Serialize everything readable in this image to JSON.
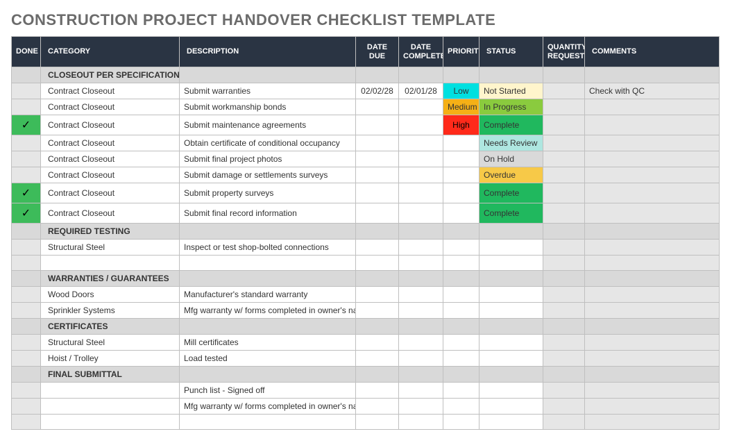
{
  "title": "CONSTRUCTION PROJECT HANDOVER CHECKLIST TEMPLATE",
  "headers": {
    "done": "DONE",
    "category": "CATEGORY",
    "description": "DESCRIPTION",
    "date_due": "DATE DUE",
    "date_completed": "DATE COMPLETED",
    "priority": "PRIORITY",
    "status": "STATUS",
    "quantity_requested": "QUANTITY REQUESTED",
    "comments": "COMMENTS"
  },
  "rows": [
    {
      "type": "section",
      "category": "CLOSEOUT PER SPECIFICATION"
    },
    {
      "type": "item",
      "done": false,
      "category": "Contract Closeout",
      "description": "Submit warranties",
      "date_due": "02/02/28",
      "date_completed": "02/01/28",
      "priority": "Low",
      "priority_class": "prio-low",
      "status": "Not Started",
      "status_class": "st-notstarted",
      "quantity": "",
      "comments": "Check with QC"
    },
    {
      "type": "item",
      "done": false,
      "category": "Contract Closeout",
      "description": "Submit workmanship bonds",
      "date_due": "",
      "date_completed": "",
      "priority": "Medium",
      "priority_class": "prio-medium",
      "status": "In Progress",
      "status_class": "st-inprogress",
      "quantity": "",
      "comments": ""
    },
    {
      "type": "item",
      "done": true,
      "category": "Contract Closeout",
      "description": "Submit maintenance agreements",
      "date_due": "",
      "date_completed": "",
      "priority": "High",
      "priority_class": "prio-high",
      "status": "Complete",
      "status_class": "st-complete",
      "quantity": "",
      "comments": ""
    },
    {
      "type": "item",
      "done": false,
      "category": "Contract Closeout",
      "description": "Obtain certificate of conditional occupancy",
      "date_due": "",
      "date_completed": "",
      "priority": "",
      "priority_class": "",
      "status": "Needs Review",
      "status_class": "st-needsreview",
      "quantity": "",
      "comments": ""
    },
    {
      "type": "item",
      "done": false,
      "category": "Contract Closeout",
      "description": "Submit final project photos",
      "date_due": "",
      "date_completed": "",
      "priority": "",
      "priority_class": "",
      "status": "On Hold",
      "status_class": "st-onhold",
      "quantity": "",
      "comments": ""
    },
    {
      "type": "item",
      "done": false,
      "category": "Contract Closeout",
      "description": "Submit damage or settlements surveys",
      "date_due": "",
      "date_completed": "",
      "priority": "",
      "priority_class": "",
      "status": "Overdue",
      "status_class": "st-overdue",
      "quantity": "",
      "comments": ""
    },
    {
      "type": "item",
      "done": true,
      "category": "Contract Closeout",
      "description": "Submit property surveys",
      "date_due": "",
      "date_completed": "",
      "priority": "",
      "priority_class": "",
      "status": "Complete",
      "status_class": "st-complete",
      "quantity": "",
      "comments": ""
    },
    {
      "type": "item",
      "done": true,
      "category": "Contract Closeout",
      "description": "Submit final record information",
      "date_due": "",
      "date_completed": "",
      "priority": "",
      "priority_class": "",
      "status": "Complete",
      "status_class": "st-complete",
      "quantity": "",
      "comments": ""
    },
    {
      "type": "section",
      "category": "REQUIRED TESTING"
    },
    {
      "type": "item",
      "done": false,
      "category": "Structural Steel",
      "description": "Inspect or test shop-bolted connections",
      "date_due": "",
      "date_completed": "",
      "priority": "",
      "priority_class": "",
      "status": "",
      "status_class": "",
      "quantity": "",
      "comments": ""
    },
    {
      "type": "blank"
    },
    {
      "type": "section",
      "category": "WARRANTIES / GUARANTEES"
    },
    {
      "type": "item",
      "done": false,
      "category": "Wood Doors",
      "description": "Manufacturer's standard warranty",
      "date_due": "",
      "date_completed": "",
      "priority": "",
      "priority_class": "",
      "status": "",
      "status_class": "",
      "quantity": "",
      "comments": ""
    },
    {
      "type": "item",
      "done": false,
      "category": "Sprinkler Systems",
      "description": "Mfg warranty w/ forms completed in owner's name",
      "date_due": "",
      "date_completed": "",
      "priority": "",
      "priority_class": "",
      "status": "",
      "status_class": "",
      "quantity": "",
      "comments": ""
    },
    {
      "type": "section",
      "category": "CERTIFICATES"
    },
    {
      "type": "item",
      "done": false,
      "category": "Structural Steel",
      "description": "Mill certificates",
      "date_due": "",
      "date_completed": "",
      "priority": "",
      "priority_class": "",
      "status": "",
      "status_class": "",
      "quantity": "",
      "comments": ""
    },
    {
      "type": "item",
      "done": false,
      "category": "Hoist / Trolley",
      "description": "Load tested",
      "date_due": "",
      "date_completed": "",
      "priority": "",
      "priority_class": "",
      "status": "",
      "status_class": "",
      "quantity": "",
      "comments": ""
    },
    {
      "type": "section",
      "category": "FINAL SUBMITTAL"
    },
    {
      "type": "item",
      "done": false,
      "category": "",
      "description": "Punch list - Signed off",
      "date_due": "",
      "date_completed": "",
      "priority": "",
      "priority_class": "",
      "status": "",
      "status_class": "",
      "quantity": "",
      "comments": ""
    },
    {
      "type": "item",
      "done": false,
      "category": "",
      "description": "Mfg warranty w/ forms completed in owner's name",
      "date_due": "",
      "date_completed": "",
      "priority": "",
      "priority_class": "",
      "status": "",
      "status_class": "",
      "quantity": "",
      "comments": ""
    },
    {
      "type": "blank"
    }
  ],
  "checkmark": "✓"
}
